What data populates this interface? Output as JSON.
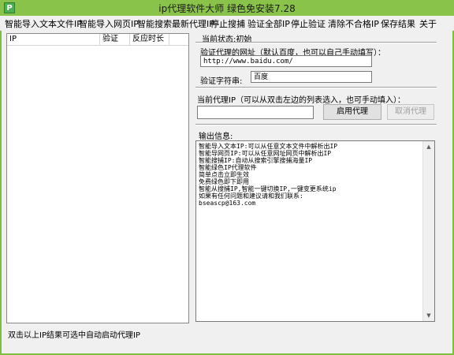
{
  "window": {
    "title": "ip代理软件大师 绿色免安装7.28",
    "icon_glyph": "P",
    "icon_name": "app-icon"
  },
  "menu": [
    "智能导入文本文件IP",
    "智能导入网页IP",
    "智能搜索最新代理IP",
    "停止搜捕",
    "验证全部IP",
    "停止验证",
    "清除不合格IP",
    "保存结果",
    "关于"
  ],
  "list": {
    "columns": [
      "IP",
      "验证",
      "反应时长"
    ],
    "rows": []
  },
  "status": "双击以上IP结果可选中自动启动代理IP",
  "right": {
    "current_status": "当前状态:初始",
    "verify_url_label": "验证代理的网址（默认百度，也可以自己手动填写）：",
    "verify_url_value": "http://www.baidu.com/",
    "verify_string_label": "验证字符串:",
    "verify_string_value": "百度",
    "proxy_label": "当前代理IP（可以从双击左边的列表选入，也可手动填入）：",
    "proxy_value": "",
    "enable_button": "启用代理",
    "cancel_button": "取消代理",
    "output_label": "输出信息:",
    "output_lines": [
      "智能导入文本IP:可以从任意文本文件中解析出IP",
      "智能导网页IP:可以从任意网址网页中解析出IP",
      "智能搜捕IP:自动从搜索引擎搜捕海量IP",
      "智能绿色IP代理软件",
      "简单点击立即生效",
      "免费绿色即下即用",
      "智能从搜捕IP,智能一键切换IP,一键变更系统ip",
      "如果有任何问题和建议请和我们联系:",
      "bseascp@163.com"
    ]
  },
  "colors": {
    "frame": "#7fbf3f",
    "titlebar": "#8ac34a",
    "panel": "#f0f0f0"
  }
}
